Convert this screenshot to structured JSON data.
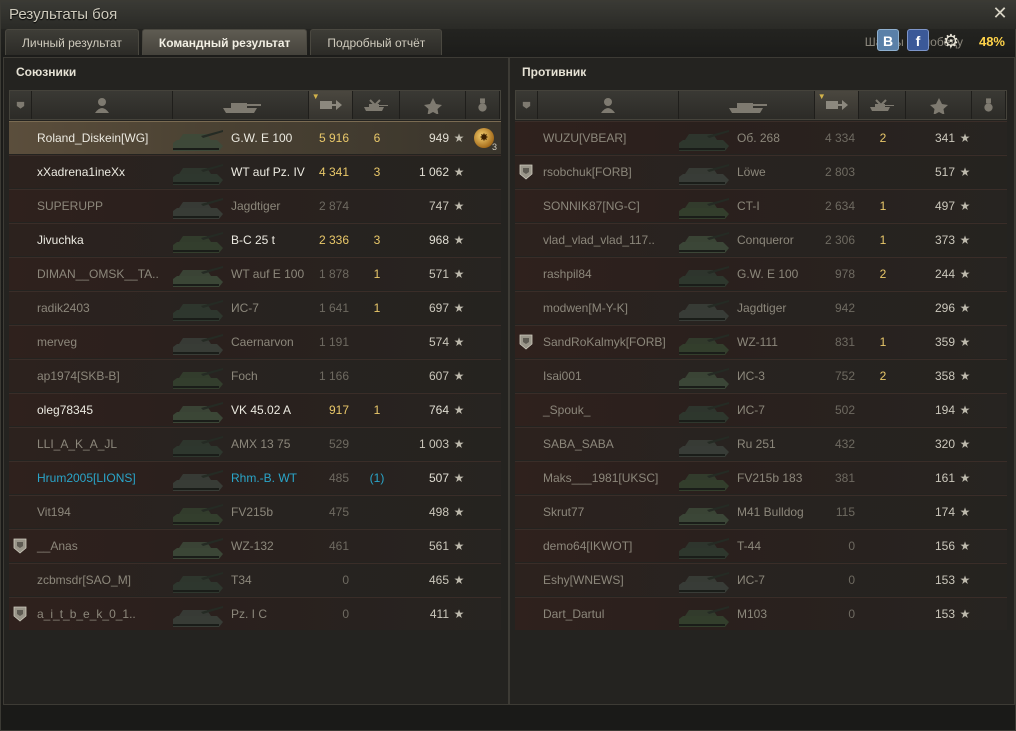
{
  "window": {
    "title": "Результаты боя",
    "close_glyph": "✕"
  },
  "tabs": [
    {
      "label": "Личный результат",
      "active": false
    },
    {
      "label": "Командный результат",
      "active": true
    },
    {
      "label": "Подробный отчёт",
      "active": false
    }
  ],
  "share": {
    "vk_label": "B",
    "fb_label": "f",
    "gear_glyph": "⚙",
    "chance_label": "Шансы на победу",
    "chance_value": "48%"
  },
  "allies": {
    "title": "Союзники",
    "headers": {
      "squad": "squad-icon",
      "player": "player-icon",
      "tank": "tank-icon",
      "damage": "damage-icon",
      "kills": "kills-icon",
      "xp": "star-icon",
      "medal": "medal-icon"
    },
    "rows": [
      {
        "name": "Roland_Diskein[WG]",
        "vehicle": "G.W. E 100",
        "damage": "5 916",
        "kills": "6",
        "xp": "949",
        "state": "alive",
        "highlight": true,
        "squad_badge": false,
        "medal": "✸",
        "medal_count": "3"
      },
      {
        "name": "xXadrena1ineXx",
        "vehicle": "WT auf Pz. IV",
        "damage": "4 341",
        "kills": "3",
        "xp": "1 062",
        "state": "alive",
        "highlight": false,
        "squad_badge": false,
        "medal": "",
        "medal_count": ""
      },
      {
        "name": "SUPERUPP",
        "vehicle": "Jagdtiger",
        "damage": "2 874",
        "kills": "",
        "xp": "747",
        "state": "dead",
        "highlight": false,
        "squad_badge": false,
        "medal": "",
        "medal_count": ""
      },
      {
        "name": "Jivuchka",
        "vehicle": "B-C 25 t",
        "damage": "2 336",
        "kills": "3",
        "xp": "968",
        "state": "alive",
        "highlight": false,
        "squad_badge": false,
        "medal": "",
        "medal_count": ""
      },
      {
        "name": "DIMAN__OMSK__TA..",
        "vehicle": "WT auf E 100",
        "damage": "1 878",
        "kills": "1",
        "xp": "571",
        "state": "dead",
        "highlight": false,
        "squad_badge": false,
        "medal": "",
        "medal_count": ""
      },
      {
        "name": "radik2403",
        "vehicle": "ИС-7",
        "damage": "1 641",
        "kills": "1",
        "xp": "697",
        "state": "dead",
        "highlight": false,
        "squad_badge": false,
        "medal": "",
        "medal_count": ""
      },
      {
        "name": "merveg",
        "vehicle": "Caernarvon",
        "damage": "1 191",
        "kills": "",
        "xp": "574",
        "state": "dead",
        "highlight": false,
        "squad_badge": false,
        "medal": "",
        "medal_count": ""
      },
      {
        "name": "ap1974[SKB-B]",
        "vehicle": "Foch",
        "damage": "1 166",
        "kills": "",
        "xp": "607",
        "state": "dead",
        "highlight": false,
        "squad_badge": false,
        "medal": "",
        "medal_count": ""
      },
      {
        "name": "oleg78345",
        "vehicle": "VK 45.02 A",
        "damage": "917",
        "kills": "1",
        "xp": "764",
        "state": "alive",
        "highlight": false,
        "squad_badge": false,
        "medal": "",
        "medal_count": ""
      },
      {
        "name": "LLI_A_K_A_JL",
        "vehicle": "AMX 13 75",
        "damage": "529",
        "kills": "",
        "xp": "1 003",
        "state": "dead",
        "highlight": false,
        "squad_badge": false,
        "medal": "",
        "medal_count": ""
      },
      {
        "name": "Hrum2005[LIONS]",
        "vehicle": "Rhm.-B. WT",
        "damage": "485",
        "kills": "(1)",
        "xp": "507",
        "state": "squad",
        "highlight": false,
        "squad_badge": false,
        "medal": "",
        "medal_count": ""
      },
      {
        "name": "Vit194",
        "vehicle": "FV215b",
        "damage": "475",
        "kills": "",
        "xp": "498",
        "state": "dead",
        "highlight": false,
        "squad_badge": false,
        "medal": "",
        "medal_count": ""
      },
      {
        "name": "__Anas",
        "vehicle": "WZ-132",
        "damage": "461",
        "kills": "",
        "xp": "561",
        "state": "dead",
        "highlight": false,
        "squad_badge": true,
        "medal": "",
        "medal_count": ""
      },
      {
        "name": "zcbmsdr[SAO_M]",
        "vehicle": "T34",
        "damage": "0",
        "kills": "",
        "xp": "465",
        "state": "dead",
        "highlight": false,
        "squad_badge": false,
        "medal": "",
        "medal_count": ""
      },
      {
        "name": "a_i_t_b_e_k_0_1..",
        "vehicle": "Pz. I C",
        "damage": "0",
        "kills": "",
        "xp": "411",
        "state": "dead",
        "highlight": false,
        "squad_badge": true,
        "medal": "",
        "medal_count": ""
      }
    ]
  },
  "enemies": {
    "title": "Противник",
    "rows": [
      {
        "name": "WUZU[VBEAR]",
        "vehicle": "Об. 268",
        "damage": "4 334",
        "kills": "2",
        "xp": "341",
        "squad_badge": false
      },
      {
        "name": "rsobchuk[FORB]",
        "vehicle": "Löwe",
        "damage": "2 803",
        "kills": "",
        "xp": "517",
        "squad_badge": true
      },
      {
        "name": "SONNIK87[NG-C]",
        "vehicle": "CT-I",
        "damage": "2 634",
        "kills": "1",
        "xp": "497",
        "squad_badge": false
      },
      {
        "name": "vlad_vlad_vlad_117..",
        "vehicle": "Conqueror",
        "damage": "2 306",
        "kills": "1",
        "xp": "373",
        "squad_badge": false
      },
      {
        "name": "rashpil84",
        "vehicle": "G.W. E 100",
        "damage": "978",
        "kills": "2",
        "xp": "244",
        "squad_badge": false
      },
      {
        "name": "modwen[M-Y-K]",
        "vehicle": "Jagdtiger",
        "damage": "942",
        "kills": "",
        "xp": "296",
        "squad_badge": false
      },
      {
        "name": "SandRoKalmyk[FORB]",
        "vehicle": "WZ-111",
        "damage": "831",
        "kills": "1",
        "xp": "359",
        "squad_badge": true
      },
      {
        "name": "Isai001",
        "vehicle": "ИС-3",
        "damage": "752",
        "kills": "2",
        "xp": "358",
        "squad_badge": false
      },
      {
        "name": "_Spouk_",
        "vehicle": "ИС-7",
        "damage": "502",
        "kills": "",
        "xp": "194",
        "squad_badge": false
      },
      {
        "name": "SABA_SABA",
        "vehicle": "Ru 251",
        "damage": "432",
        "kills": "",
        "xp": "320",
        "squad_badge": false
      },
      {
        "name": "Maks___1981[UKSC]",
        "vehicle": "FV215b 183",
        "damage": "381",
        "kills": "",
        "xp": "161",
        "squad_badge": false
      },
      {
        "name": "Skrut77",
        "vehicle": "M41 Bulldog",
        "damage": "115",
        "kills": "",
        "xp": "174",
        "squad_badge": false
      },
      {
        "name": "demo64[IKWOT]",
        "vehicle": "T-44",
        "damage": "0",
        "kills": "",
        "xp": "156",
        "squad_badge": false
      },
      {
        "name": "Eshy[WNEWS]",
        "vehicle": "ИС-7",
        "damage": "0",
        "kills": "",
        "xp": "153",
        "squad_badge": false
      },
      {
        "name": "Dart_Dartul",
        "vehicle": "M103",
        "damage": "0",
        "kills": "",
        "xp": "153",
        "squad_badge": false
      }
    ]
  },
  "colors": {
    "accent_gold": "#e9c86a",
    "squad_blue": "#2aa5c9",
    "chance": "#ffd34a"
  },
  "star_glyph": "★"
}
